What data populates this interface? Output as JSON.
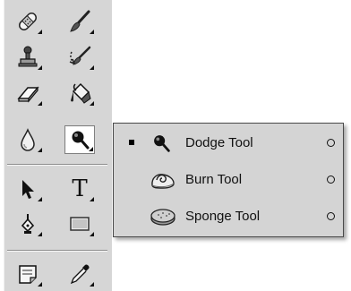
{
  "toolbar": {
    "tools": [
      {
        "name": "healing-brush-tool",
        "icon": "bandage-icon"
      },
      {
        "name": "brush-tool",
        "icon": "brush-icon"
      },
      {
        "name": "clone-stamp-tool",
        "icon": "stamp-icon"
      },
      {
        "name": "history-brush-tool",
        "icon": "history-brush-icon"
      },
      {
        "name": "eraser-tool",
        "icon": "eraser-icon"
      },
      {
        "name": "paint-bucket-tool",
        "icon": "paint-bucket-icon"
      },
      {
        "name": "blur-tool",
        "icon": "drop-icon"
      },
      {
        "name": "dodge-tool",
        "icon": "dodge-icon",
        "active": true
      },
      {
        "name": "path-selection-tool",
        "icon": "arrow-icon"
      },
      {
        "name": "type-tool",
        "icon": "type-icon",
        "glyph": "T"
      },
      {
        "name": "pen-tool",
        "icon": "pen-icon"
      },
      {
        "name": "shape-tool",
        "icon": "rectangle-icon"
      },
      {
        "name": "notes-tool",
        "icon": "note-icon"
      },
      {
        "name": "eyedropper-tool",
        "icon": "eyedropper-icon"
      }
    ]
  },
  "flyout": {
    "items": [
      {
        "label": "Dodge Tool",
        "icon": "dodge-icon",
        "selected": true,
        "shortcut": "O"
      },
      {
        "label": "Burn Tool",
        "icon": "burn-icon",
        "selected": false,
        "shortcut": "O"
      },
      {
        "label": "Sponge Tool",
        "icon": "sponge-icon",
        "selected": false,
        "shortcut": "O"
      }
    ]
  }
}
